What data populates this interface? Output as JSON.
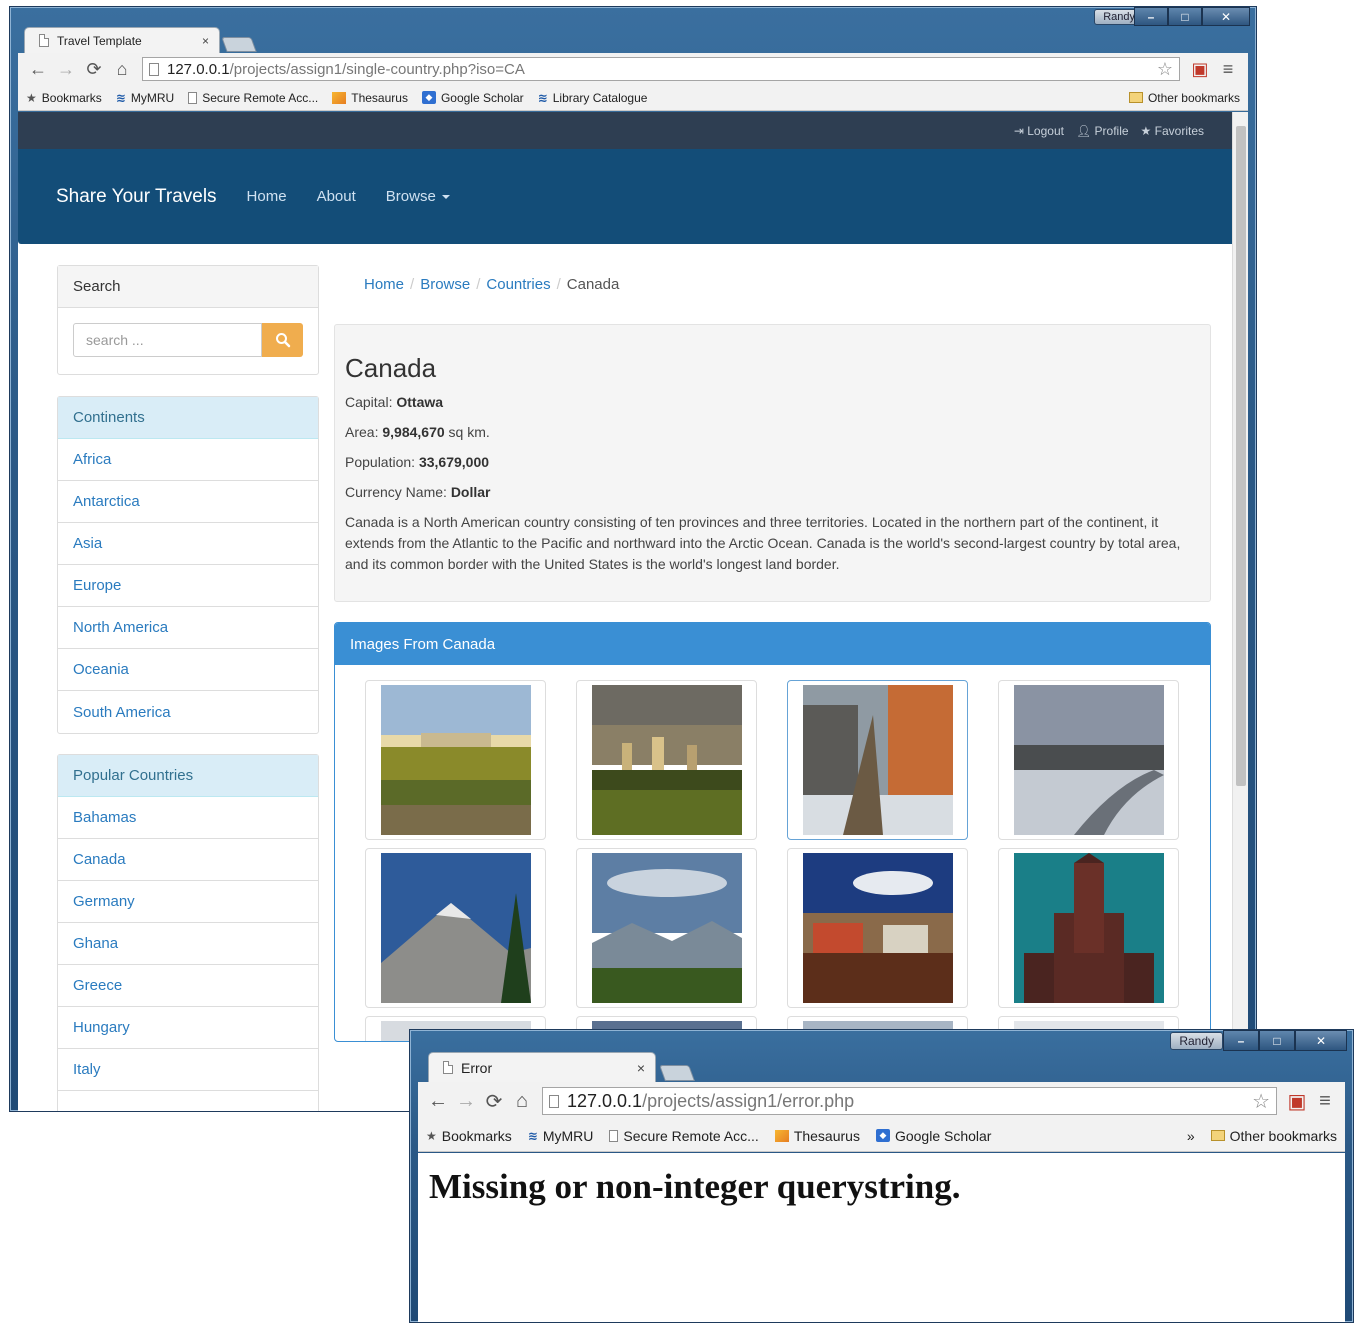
{
  "window1": {
    "tab_title": "Travel Template",
    "tab_close": "×",
    "user": "Randy",
    "controls": {
      "minimize": "–",
      "maximize": "□",
      "close": "✕"
    },
    "url_host": "127.0.0.1",
    "url_path": "/projects/assign1/single-country.php?iso=CA",
    "bookmarks": [
      "Bookmarks",
      "MyMRU",
      "Secure Remote Acc...",
      "Thesaurus",
      "Google Scholar",
      "Library Catalogue"
    ],
    "other_bookmarks": "Other bookmarks"
  },
  "site": {
    "top_links": {
      "logout": "Logout",
      "profile": "Profile",
      "favorites": "Favorites"
    },
    "brand": "Share Your Travels",
    "nav": {
      "home": "Home",
      "about": "About",
      "browse": "Browse"
    },
    "search": {
      "title": "Search",
      "placeholder": "search ..."
    },
    "continents": {
      "title": "Continents",
      "items": [
        "Africa",
        "Antarctica",
        "Asia",
        "Europe",
        "North America",
        "Oceania",
        "South America"
      ]
    },
    "popular": {
      "title": "Popular Countries",
      "items": [
        "Bahamas",
        "Canada",
        "Germany",
        "Ghana",
        "Greece",
        "Hungary",
        "Italy"
      ]
    },
    "breadcrumb": {
      "home": "Home",
      "browse": "Browse",
      "countries": "Countries",
      "current": "Canada"
    },
    "country": {
      "name": "Canada",
      "capital_label": "Capital:",
      "capital": "Ottawa",
      "area_label": "Area:",
      "area": "9,984,670",
      "area_unit": "sq km.",
      "population_label": "Population:",
      "population": "33,679,000",
      "currency_label": "Currency Name:",
      "currency": "Dollar",
      "description": "Canada is a North American country consisting of ten provinces and three territories. Located in the northern part of the continent, it extends from the Atlantic to the Pacific and northward into the Arctic Ocean. Canada is the world's second-largest country by total area, and its common border with the United States is the world's longest land border."
    },
    "images_title": "Images From Canada"
  },
  "window2": {
    "tab_title": "Error",
    "tab_close": "×",
    "user": "Randy",
    "controls": {
      "minimize": "–",
      "maximize": "□",
      "close": "✕"
    },
    "url_host": "127.0.0.1",
    "url_path": "/projects/assign1/error.php",
    "bookmarks": [
      "Bookmarks",
      "MyMRU",
      "Secure Remote Acc...",
      "Thesaurus",
      "Google Scholar"
    ],
    "overflow": "»",
    "other_bookmarks": "Other bookmarks",
    "message": "Missing or non-integer querystring."
  },
  "colors": {
    "navbar": "#134d78",
    "topbar": "#2e3e52",
    "link": "#2a7bbf",
    "panel_primary": "#3a8fd4",
    "search_button": "#f0ad4e"
  }
}
